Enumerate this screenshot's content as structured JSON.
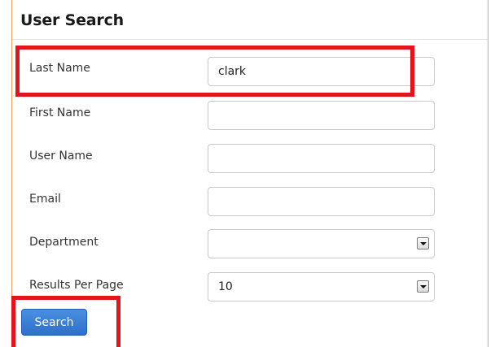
{
  "panel": {
    "title": "User Search"
  },
  "form": {
    "last_name": {
      "label": "Last Name",
      "value": "clark",
      "placeholder": ""
    },
    "first_name": {
      "label": "First Name",
      "value": "",
      "placeholder": ""
    },
    "user_name": {
      "label": "User Name",
      "value": "",
      "placeholder": ""
    },
    "email": {
      "label": "Email",
      "value": "",
      "placeholder": ""
    },
    "department": {
      "label": "Department",
      "selected": ""
    },
    "results_per_page": {
      "label": "Results Per Page",
      "selected": "10"
    }
  },
  "actions": {
    "search_label": "Search"
  },
  "colors": {
    "panel_border": "#e8a36a",
    "highlight": "#e3141c",
    "button": "#2f6fc9"
  }
}
